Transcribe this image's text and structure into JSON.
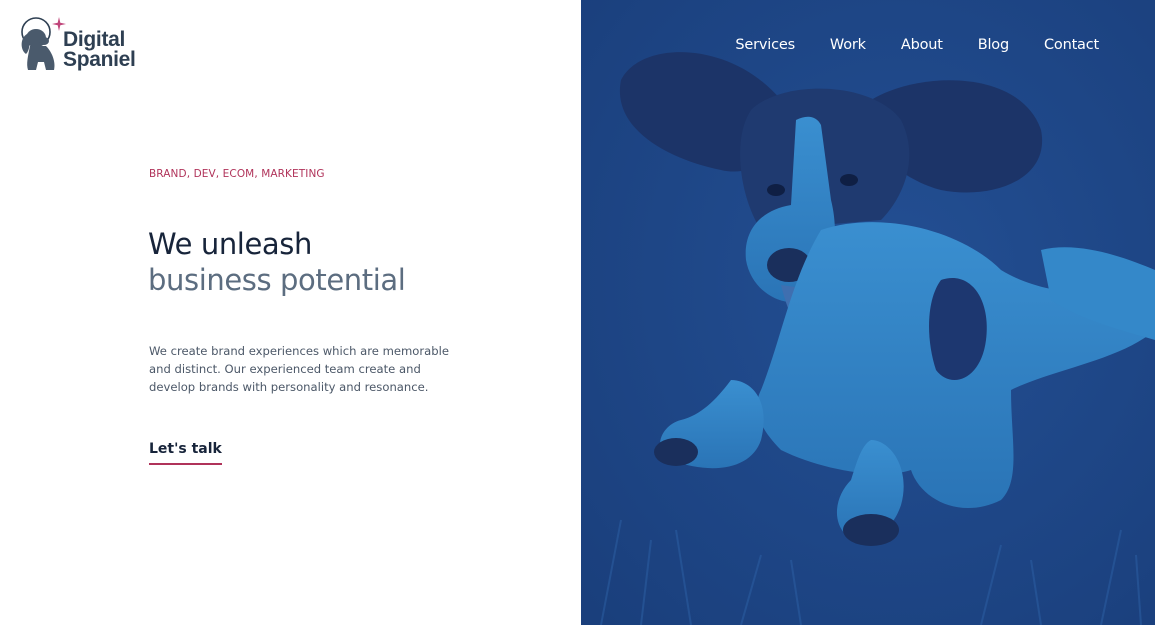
{
  "brand": {
    "name_line1": "Digital",
    "name_line2": "Spaniel",
    "logo_icon": "spaniel-astronaut-icon",
    "sparkle_icon": "sparkle-icon"
  },
  "nav": {
    "items": [
      {
        "label": "Services"
      },
      {
        "label": "Work"
      },
      {
        "label": "About"
      },
      {
        "label": "Blog"
      },
      {
        "label": "Contact"
      }
    ]
  },
  "hero": {
    "eyebrow": "BRAND, DEV, ECOM, MARKETING",
    "headline_line1": "We unleash",
    "headline_line2": "business potential",
    "body": "We create brand experiences which are memorable and distinct. Our experienced team create and develop brands with personality and resonance.",
    "cta_label": "Let's talk",
    "image_icon": "running-spaniel-photo"
  },
  "colors": {
    "accent": "#b0335a",
    "heading_dark": "#17243a",
    "heading_muted": "#5c6d80",
    "hero_blue_dark": "#1e3f7d",
    "hero_blue_light": "#2f84c6"
  }
}
